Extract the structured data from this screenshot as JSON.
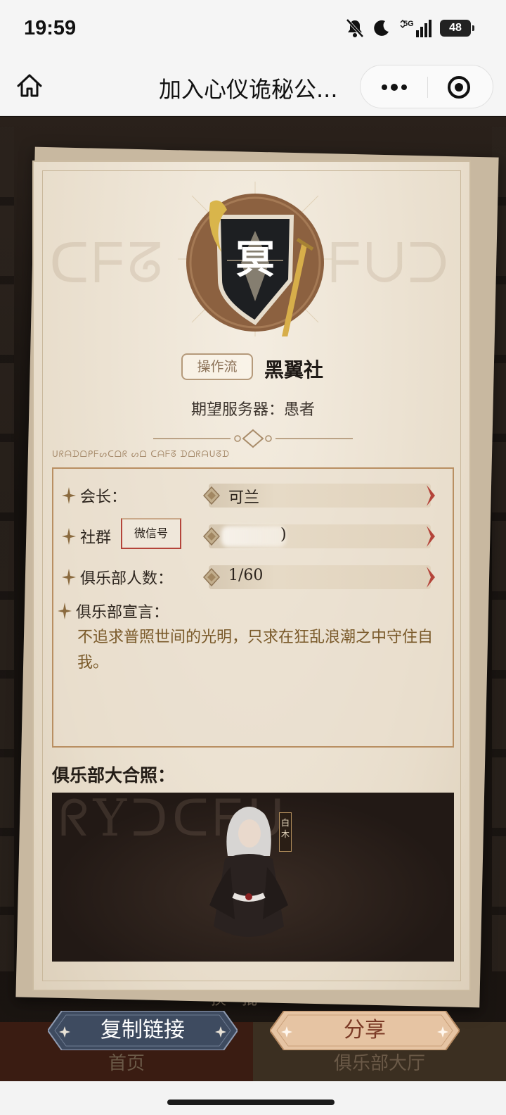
{
  "status_bar": {
    "time": "19:59",
    "network": "5G",
    "battery": "48",
    "icons": [
      "bell-off-icon",
      "moon-icon",
      "signal-icon",
      "battery-icon"
    ]
  },
  "nav": {
    "title": "加入心仪诡秘公...",
    "icons": [
      "home-icon",
      "more-icon",
      "target-icon"
    ]
  },
  "club": {
    "emblem_char": "冥",
    "style_tag": "操作流",
    "name": "黑翼社",
    "server": "期望服务器：愚者",
    "ornament_script": "ᑌᖇᗩᗪᗝᑭᖴᔕᑕᗝᖇ ᔕᗝ ᑕᗩᖴᘔ ᗪᗝᖇᗩᑌᘔᗪ"
  },
  "info": {
    "leader_label": "会长：",
    "leader_value": "可兰",
    "group_label": "社群",
    "wechat_button": "微信号",
    "group_value": ")",
    "members_label": "俱乐部人数：",
    "members_value": "1/60",
    "manifesto_label": "俱乐部宣言：",
    "manifesto_text": "不追求普照世间的光明，只求在狂乱浪潮之中守住自我。"
  },
  "photo": {
    "title": "俱乐部大合照：",
    "member_tag": "白木"
  },
  "background": {
    "refresh_label": "换一批",
    "tab_home": "首页",
    "tab_hall": "俱乐部大厅"
  },
  "actions": {
    "copy_link": "复制链接",
    "share": "分享"
  },
  "colors": {
    "accent_brown": "#7a5a2a",
    "card_bg": "#efe6d6",
    "copy_btn": "#3d4a5e",
    "share_btn": "#e8c7a8",
    "arrow_red": "#b4443a"
  }
}
